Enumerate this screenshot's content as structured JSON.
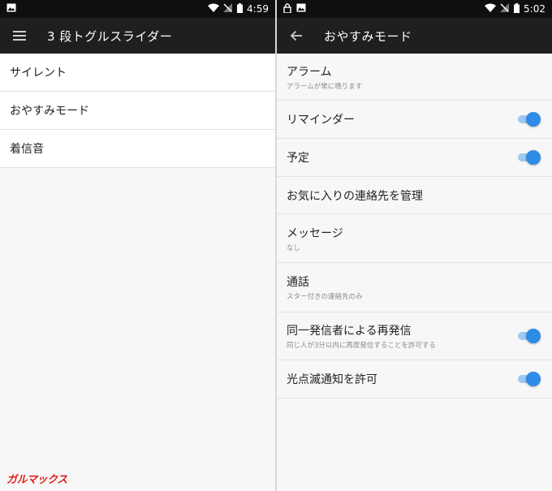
{
  "colors": {
    "status_bar": "#0f0f0f",
    "app_bar": "#1f1f1f",
    "background": "#f7f7f7",
    "toggle_on": "#2e8be6",
    "toggle_track": "#9ec9ee",
    "watermark": "#e02020"
  },
  "left": {
    "status": {
      "time": "4:59"
    },
    "appbar": {
      "icon": "menu-icon",
      "title": "3 段トグルスライダー"
    },
    "items": [
      {
        "label": "サイレント"
      },
      {
        "label": "おやすみモード"
      },
      {
        "label": "着信音"
      }
    ]
  },
  "right": {
    "status": {
      "time": "5:02"
    },
    "appbar": {
      "icon": "back-arrow-icon",
      "title": "おやすみモード"
    },
    "items": [
      {
        "title": "アラーム",
        "subtitle": "アラームが常に鳴ります"
      },
      {
        "title": "リマインダー",
        "toggle": "on"
      },
      {
        "title": "予定",
        "toggle": "on"
      },
      {
        "title": "お気に入りの連絡先を管理"
      },
      {
        "title": "メッセージ",
        "subtitle": "なし"
      },
      {
        "title": "通話",
        "subtitle": "スター付きの連絡先のみ"
      },
      {
        "title": "同一発信者による再発信",
        "subtitle": "同じ人が3分以内に再度発信することを許可する",
        "toggle": "on"
      },
      {
        "title": "光点滅通知を許可",
        "toggle": "on"
      }
    ]
  },
  "watermark": "ガルマックス"
}
